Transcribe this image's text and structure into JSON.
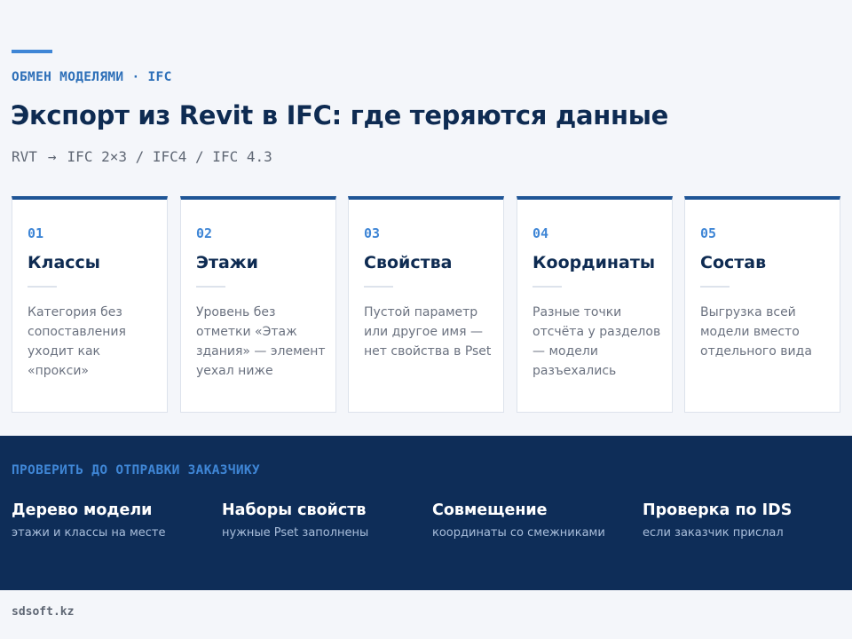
{
  "header": {
    "kicker": "ОБМЕН МОДЕЛЯМИ · IFC",
    "title": "Экспорт из Revit в IFC: где теряются данные",
    "format_from": "RVT",
    "arrow": "→",
    "format_to": "IFC 2×3 / IFC4 / IFC 4.3"
  },
  "cards": [
    {
      "num": "01",
      "title": "Классы",
      "desc": "Категория без сопоставления уходит как «прокси»"
    },
    {
      "num": "02",
      "title": "Этажи",
      "desc": "Уровень без отметки «Этаж здания» — элемент уехал ниже"
    },
    {
      "num": "03",
      "title": "Свойства",
      "desc": "Пустой параметр или другое имя — нет свойства в Pset"
    },
    {
      "num": "04",
      "title": "Координаты",
      "desc": "Разные точки отсчёта у разделов — модели разъехались"
    },
    {
      "num": "05",
      "title": "Состав",
      "desc": "Выгрузка всей модели вместо отдельного вида"
    }
  ],
  "checklist": {
    "heading": "ПРОВЕРИТЬ ДО ОТПРАВКИ ЗАКАЗЧИКУ",
    "items": [
      {
        "title": "Дерево модели",
        "desc": "этажи и классы на месте"
      },
      {
        "title": "Наборы свойств",
        "desc": "нужные Pset заполнены"
      },
      {
        "title": "Совмещение",
        "desc": "координаты со смежниками"
      },
      {
        "title": "Проверка по IDS",
        "desc": "если заказчик прислал"
      }
    ]
  },
  "footer": {
    "site": "sdsoft.kz"
  },
  "colors": {
    "accent": "#3f86d6",
    "navy": "#0e2d58",
    "card_top": "#1f5596"
  }
}
